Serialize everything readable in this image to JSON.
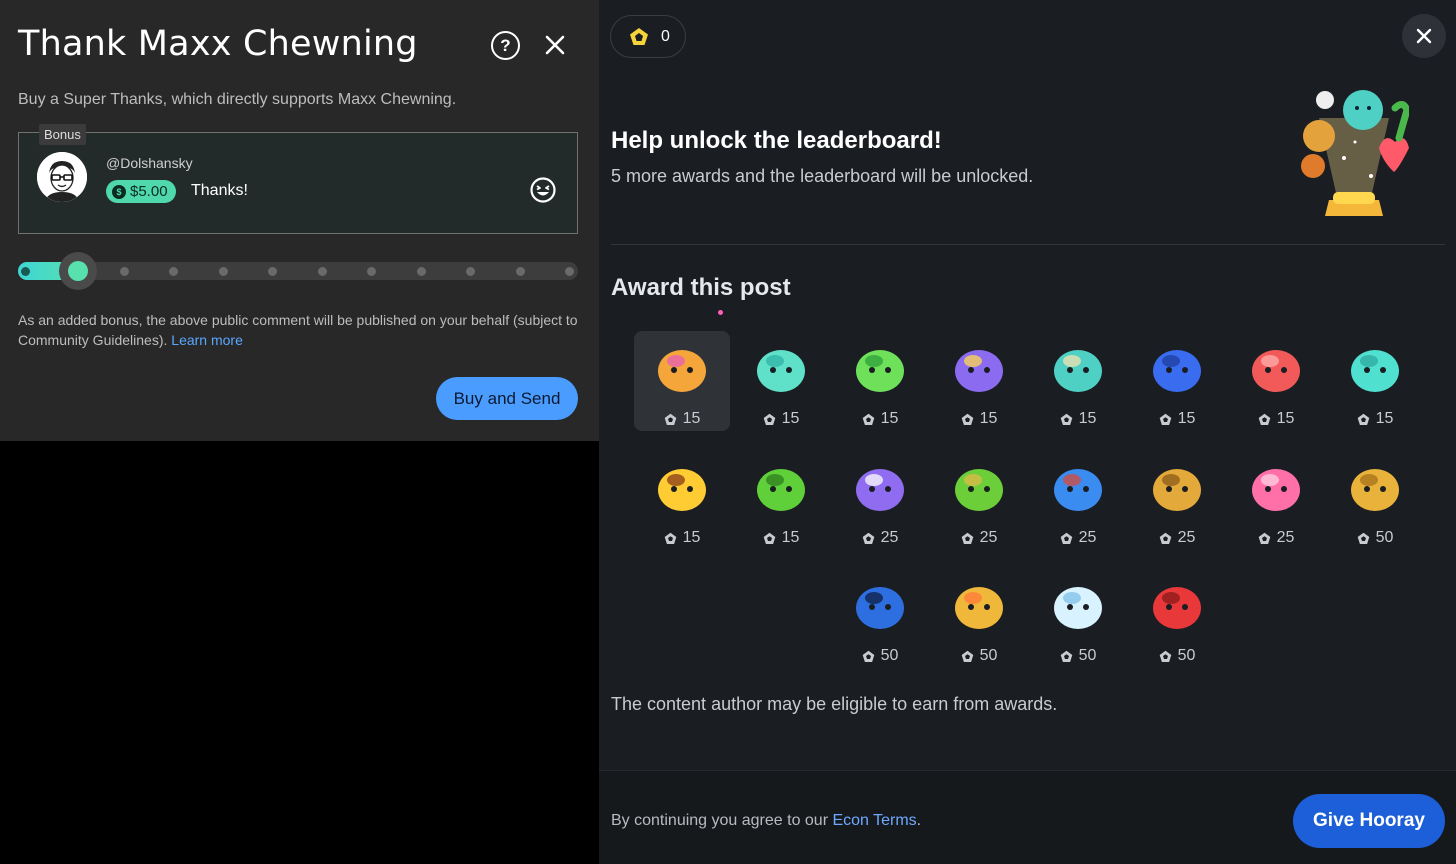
{
  "super_thanks": {
    "title": "Thank Maxx Chewning",
    "subtitle": "Buy a Super Thanks, which directly supports Maxx Chewning.",
    "bonus_tag": "Bonus",
    "handle": "@Dolshansky",
    "amount": "$5.00",
    "comment": "Thanks!",
    "slider_level": 0.1,
    "bonus_note": "As an added bonus, the above public comment will be published on your behalf (subject to Community Guidelines).",
    "learn_more": "Learn more",
    "buy_button": "Buy and Send",
    "colors": {
      "accent": "#58e0ad",
      "button": "#4a9cff"
    }
  },
  "awards_panel": {
    "balance": "0",
    "leaderboard_title": "Help unlock the leaderboard!",
    "leaderboard_sub": "5 more awards and the leaderboard will be unlocked.",
    "section_title": "Award this post",
    "awards": [
      {
        "icon": "party-popper-icon",
        "cost": "15",
        "selected": true
      },
      {
        "icon": "raised-hand-icon",
        "cost": "15"
      },
      {
        "icon": "pointing-finger-icon",
        "cost": "15"
      },
      {
        "icon": "star-eyes-blob-icon",
        "cost": "15"
      },
      {
        "icon": "sleepy-whale-icon",
        "cost": "15"
      },
      {
        "icon": "blue-blob-icon",
        "cost": "15"
      },
      {
        "icon": "red-grumpy-blob-icon",
        "cost": "15"
      },
      {
        "icon": "clapping-hands-icon",
        "cost": "15"
      },
      {
        "icon": "laughing-star-icon",
        "cost": "15"
      },
      {
        "icon": "green-snake-icon",
        "cost": "15"
      },
      {
        "icon": "confused-purple-blob-icon",
        "cost": "25"
      },
      {
        "icon": "green-creature-icon",
        "cost": "25"
      },
      {
        "icon": "blue-helicopter-blob-icon",
        "cost": "25"
      },
      {
        "icon": "golden-pastry-icon",
        "cost": "25"
      },
      {
        "icon": "pink-heart-icon",
        "cost": "25"
      },
      {
        "icon": "golden-poop-icon",
        "cost": "50"
      },
      {
        "icon": "galaxy-brain-icon",
        "cost": "50"
      },
      {
        "icon": "eye-pyramid-icon",
        "cost": "50"
      },
      {
        "icon": "diamond-icon",
        "cost": "50"
      },
      {
        "icon": "angry-red-blob-icon",
        "cost": "50"
      }
    ],
    "author_note": "The content author may be eligible to earn from awards.",
    "terms_prefix": "By continuing you agree to our",
    "terms_link": "Econ Terms",
    "terms_suffix": ".",
    "give_button": "Give Hooray",
    "colors": {
      "give_button": "#1c5fd8",
      "coin": "#f5d33a"
    }
  }
}
